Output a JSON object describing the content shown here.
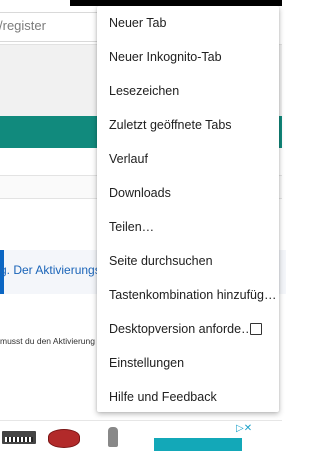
{
  "page": {
    "url_text": "/register",
    "link_text": "g. Der Aktivierungsli",
    "note_text": "musst du den Aktivierung",
    "ad": {
      "close_glyph": "▷✕"
    }
  },
  "menu": {
    "items": [
      {
        "label": "Neuer Tab"
      },
      {
        "label": "Neuer Inkognito-Tab"
      },
      {
        "label": "Lesezeichen"
      },
      {
        "label": "Zuletzt geöffnete Tabs"
      },
      {
        "label": "Verlauf"
      },
      {
        "label": "Downloads"
      },
      {
        "label": "Teilen…"
      },
      {
        "label": "Seite durchsuchen"
      },
      {
        "label": "Tastenkombination hinzufüg…"
      },
      {
        "label": "Desktopversion anforde…",
        "checkbox": false
      },
      {
        "label": "Einstellungen"
      },
      {
        "label": "Hilfe und Feedback"
      }
    ]
  }
}
